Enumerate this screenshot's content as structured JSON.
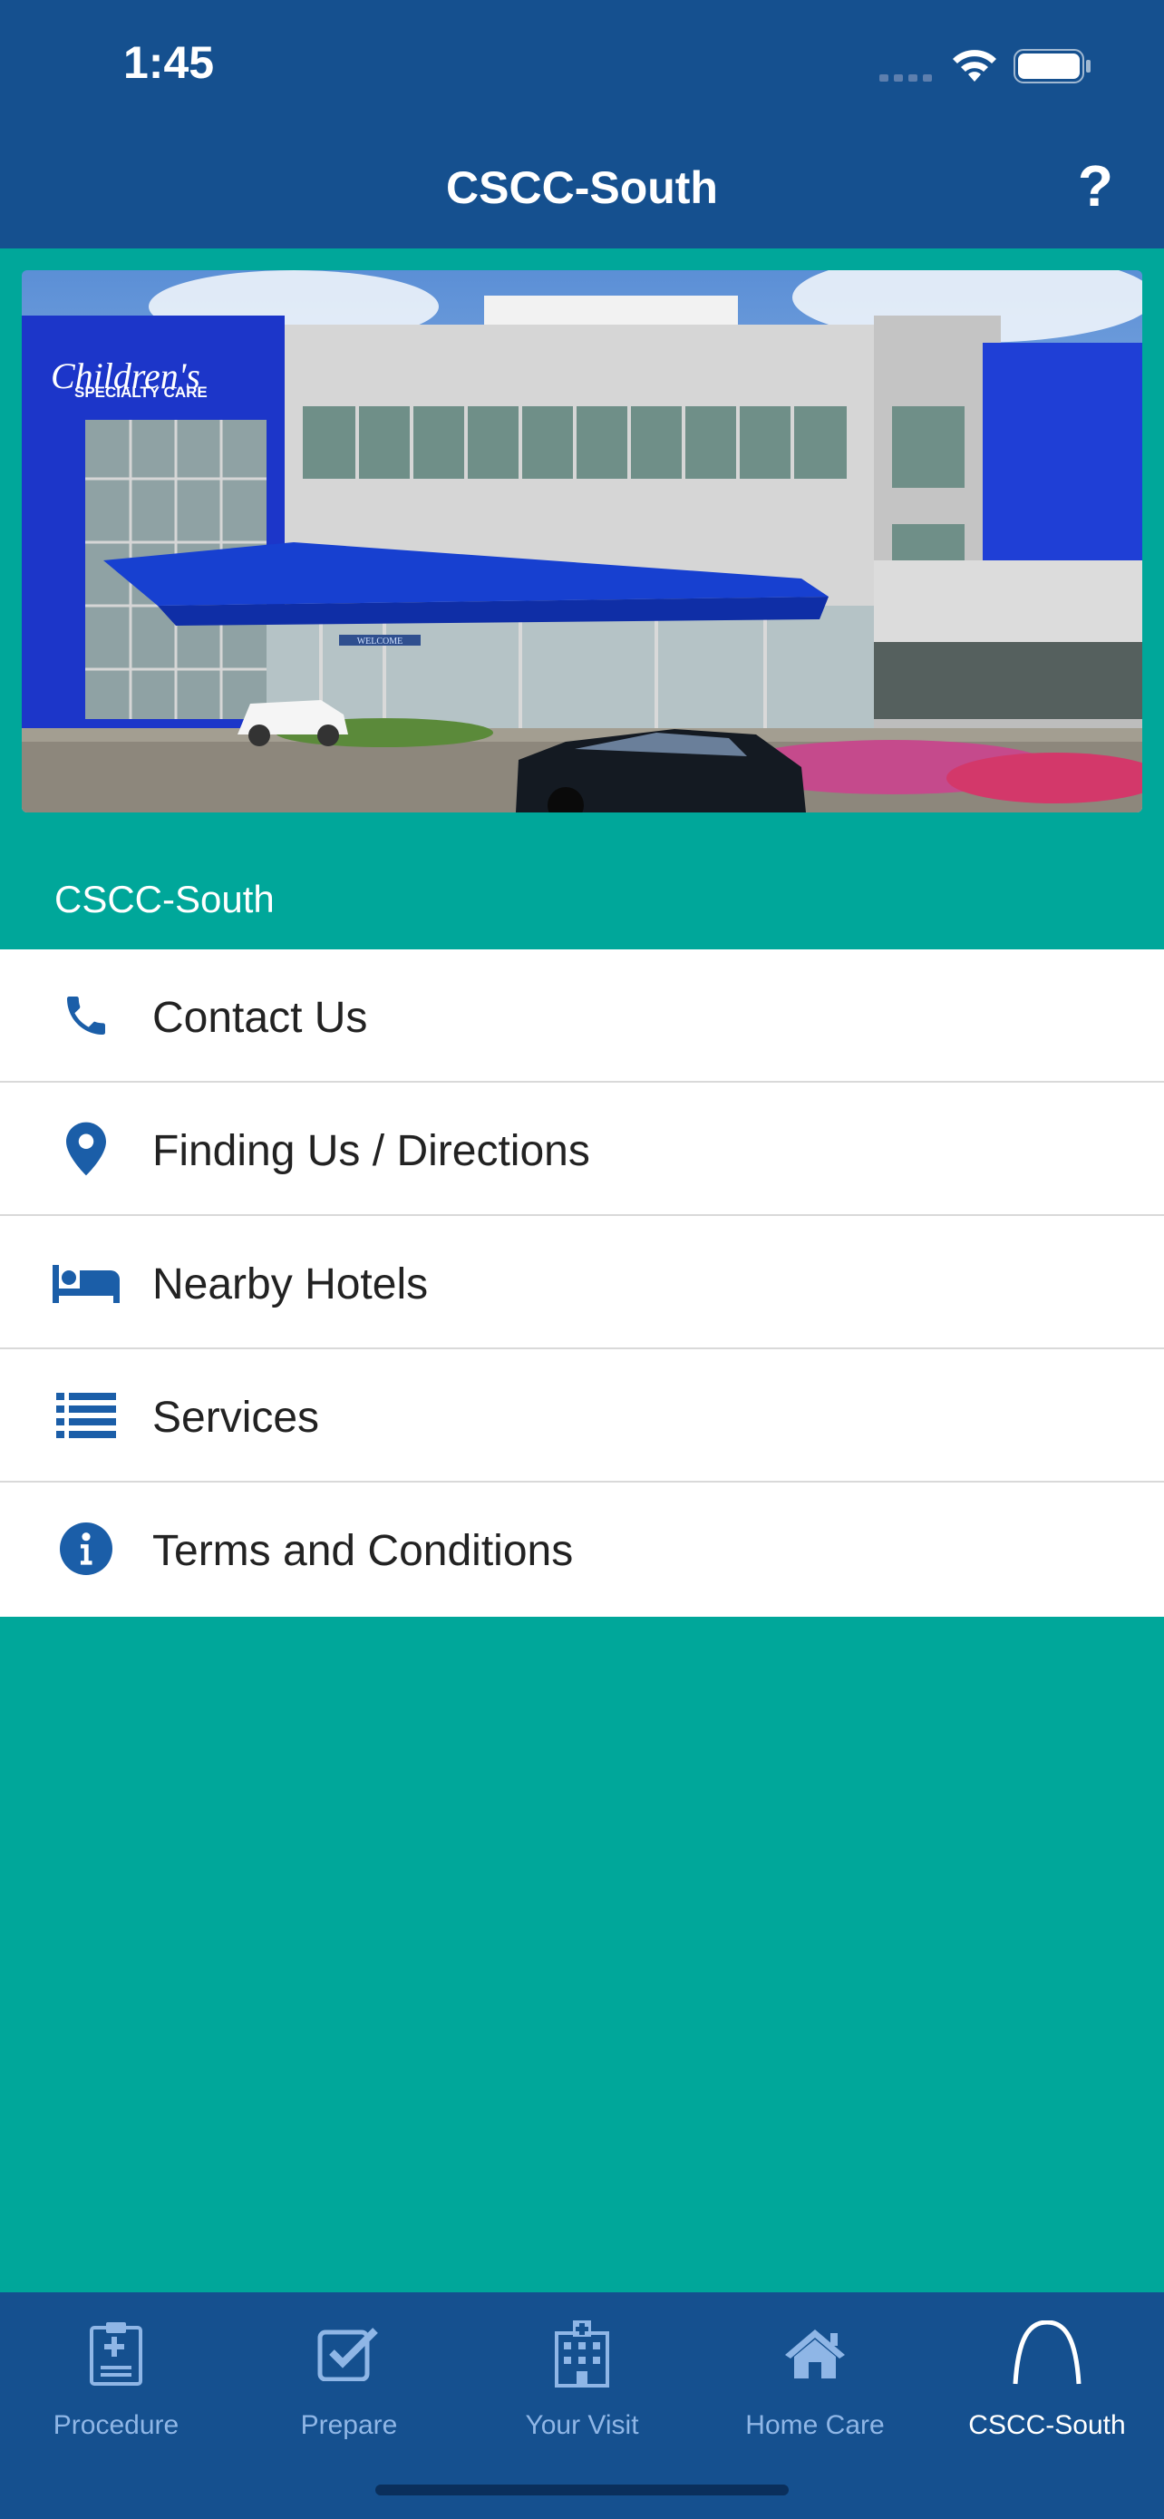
{
  "status": {
    "time": "1:45"
  },
  "nav": {
    "title": "CSCC-South",
    "help": "?"
  },
  "hero": {
    "sign_line1": "Children's",
    "sign_line2": "SPECIALTY CARE",
    "canopy": "WELCOME"
  },
  "section": {
    "title": "CSCC-South"
  },
  "list": [
    {
      "label": "Contact Us",
      "icon": "phone-icon"
    },
    {
      "label": "Finding Us / Directions",
      "icon": "map-pin-icon"
    },
    {
      "label": "Nearby Hotels",
      "icon": "bed-icon"
    },
    {
      "label": "Services",
      "icon": "list-icon"
    },
    {
      "label": "Terms and Conditions",
      "icon": "info-icon"
    }
  ],
  "tabs": [
    {
      "label": "Procedure",
      "icon": "clipboard-plus-icon"
    },
    {
      "label": "Prepare",
      "icon": "checkbox-icon"
    },
    {
      "label": "Your Visit",
      "icon": "hospital-icon"
    },
    {
      "label": "Home Care",
      "icon": "house-icon"
    },
    {
      "label": "CSCC-South",
      "icon": "arch-icon",
      "active": true
    }
  ],
  "colors": {
    "brand_blue": "#15508F",
    "teal": "#00A79A",
    "icon_blue": "#1B5EA8",
    "tab_inactive": "#8FB6E6"
  }
}
